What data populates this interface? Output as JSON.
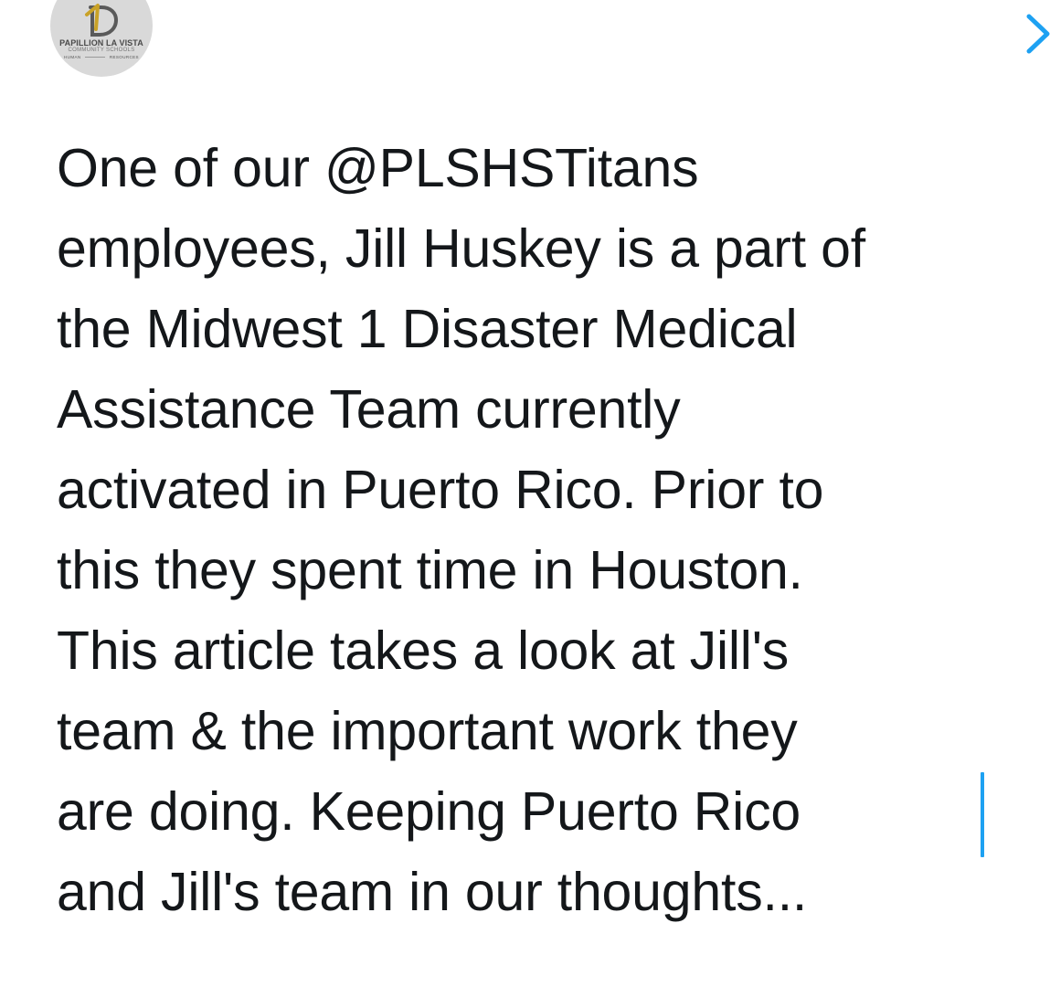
{
  "profile": {
    "logo_title": "PAPILLION LA VISTA",
    "logo_subtitle": "COMMUNITY SCHOOLS",
    "logo_department_left": "HUMAN",
    "logo_department_right": "RESOURCES",
    "logo_icon": "pd-monogram-logo",
    "accent_color": "#c9a227"
  },
  "nav": {
    "next_icon": "chevron-right-icon",
    "accent_color": "#1da1f2"
  },
  "tweet": {
    "lines": [
      "One of our @PLSHSTitans",
      "employees, Jill Huskey is a part of",
      "the Midwest 1 Disaster Medical",
      "Assistance Team currently",
      "activated in Puerto Rico. Prior to",
      "this they spent time in Houston.",
      "This article takes a look at Jill's",
      "team & the important work they",
      "are doing. Keeping Puerto Rico",
      "and Jill's team in our thoughts..."
    ],
    "text_color": "#14171a"
  }
}
